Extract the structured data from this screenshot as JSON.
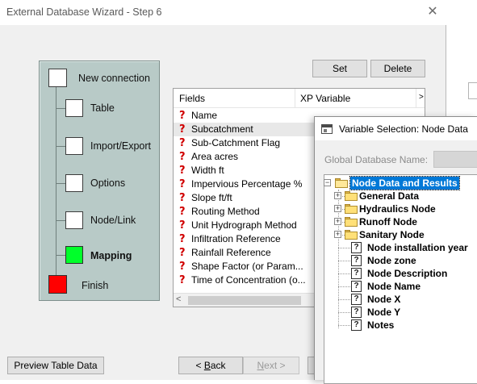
{
  "wizard": {
    "title": "External Database Wizard - Step 6",
    "close_glyph": "✕",
    "steps": [
      {
        "label": "New connection",
        "state": "done"
      },
      {
        "label": "Table",
        "state": "done"
      },
      {
        "label": "Import/Export",
        "state": "done"
      },
      {
        "label": "Options",
        "state": "done"
      },
      {
        "label": "Node/Link",
        "state": "done"
      },
      {
        "label": "Mapping",
        "state": "current"
      },
      {
        "label": "Finish",
        "state": "finish"
      }
    ],
    "buttons": {
      "set": "Set",
      "delete": "Delete",
      "preview": "Preview Table Data",
      "back_prefix": "< ",
      "back_key": "B",
      "back_rest": "ack",
      "next_key": "N",
      "next_rest": "ext >"
    },
    "fields_table": {
      "columns": [
        "Fields",
        "XP Variable"
      ],
      "rows": [
        "Name",
        "Subcatchment",
        "Sub-Catchment Flag",
        "Area acres",
        "Width ft",
        "Impervious Percentage %",
        "Slope ft/ft",
        "Routing Method",
        "Unit Hydrograph Method",
        "Infiltration Reference",
        "Rainfall Reference",
        "Shape Factor (or Param...",
        "Time of Concentration (o..."
      ],
      "selected_row": "Subcatchment",
      "scroll_left_glyph": "<",
      "header_overflow_glyph": ">"
    }
  },
  "variable_dialog": {
    "title": "Variable Selection: Node Data",
    "global_db_label": "Global Database Name:",
    "tree": {
      "root": "Node Data and Results",
      "folders": [
        "General Data",
        "Hydraulics Node",
        "Runoff Node",
        "Sanitary Node"
      ],
      "leaves": [
        "Node installation year",
        "Node zone",
        "Node Description",
        "Node Name",
        "Node X",
        "Node Y",
        "Notes"
      ]
    }
  },
  "colors": {
    "steps_panel": "#b8cac7",
    "current_step": "#00ff2a",
    "finish_step": "#ff0000",
    "selection": "#0078d7",
    "required_marker": "#d00000"
  }
}
